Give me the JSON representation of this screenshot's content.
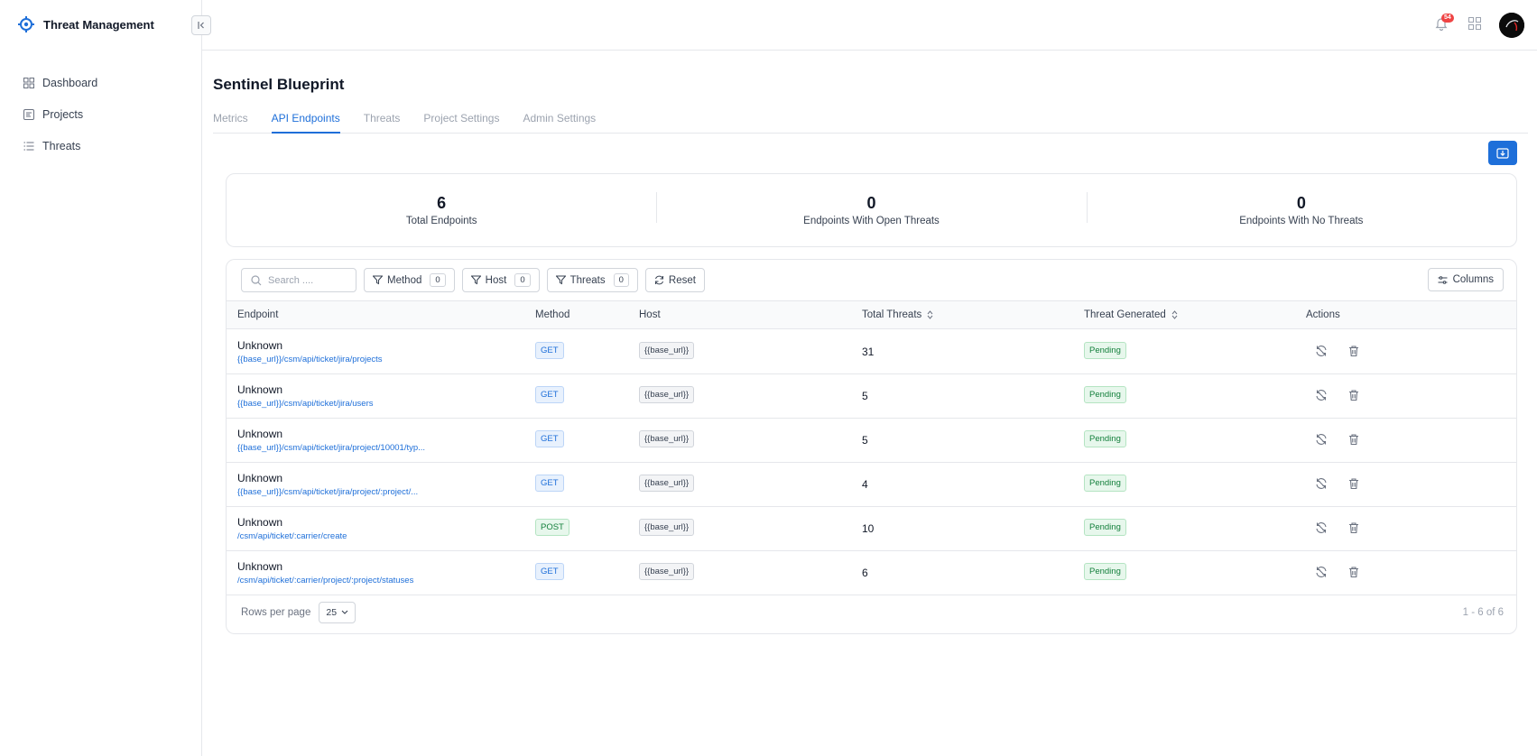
{
  "app": {
    "title": "Threat Management"
  },
  "sidebar": {
    "items": [
      {
        "label": "Dashboard",
        "icon": "grid-icon"
      },
      {
        "label": "Projects",
        "icon": "project-icon"
      },
      {
        "label": "Threats",
        "icon": "list-icon"
      }
    ]
  },
  "header": {
    "notification_count": "54"
  },
  "page": {
    "title": "Sentinel Blueprint",
    "tabs": [
      "Metrics",
      "API Endpoints",
      "Threats",
      "Project Settings",
      "Admin Settings"
    ],
    "active_tab": "API Endpoints"
  },
  "stats": [
    {
      "value": "6",
      "label": "Total Endpoints"
    },
    {
      "value": "0",
      "label": "Endpoints With Open Threats"
    },
    {
      "value": "0",
      "label": "Endpoints With No Threats"
    }
  ],
  "toolbar": {
    "search_placeholder": "Search ....",
    "filters": [
      {
        "label": "Method",
        "count": "0"
      },
      {
        "label": "Host",
        "count": "0"
      },
      {
        "label": "Threats",
        "count": "0"
      }
    ],
    "reset_label": "Reset",
    "columns_label": "Columns"
  },
  "table": {
    "headers": [
      "Endpoint",
      "Method",
      "Host",
      "Total Threats",
      "Threat Generated",
      "Actions"
    ],
    "rows": [
      {
        "name": "Unknown",
        "path": "{{base_url}}/csm/api/ticket/jira/projects",
        "method": "GET",
        "host": "{{base_url}}",
        "threats": "31",
        "status": "Pending"
      },
      {
        "name": "Unknown",
        "path": "{{base_url}}/csm/api/ticket/jira/users",
        "method": "GET",
        "host": "{{base_url}}",
        "threats": "5",
        "status": "Pending"
      },
      {
        "name": "Unknown",
        "path": "{{base_url}}/csm/api/ticket/jira/project/10001/typ...",
        "method": "GET",
        "host": "{{base_url}}",
        "threats": "5",
        "status": "Pending"
      },
      {
        "name": "Unknown",
        "path": "{{base_url}}/csm/api/ticket/jira/project/:project/...",
        "method": "GET",
        "host": "{{base_url}}",
        "threats": "4",
        "status": "Pending"
      },
      {
        "name": "Unknown",
        "path": "/csm/api/ticket/:carrier/create",
        "method": "POST",
        "host": "{{base_url}}",
        "threats": "10",
        "status": "Pending"
      },
      {
        "name": "Unknown",
        "path": "/csm/api/ticket/:carrier/project/:project/statuses",
        "method": "GET",
        "host": "{{base_url}}",
        "threats": "6",
        "status": "Pending"
      }
    ]
  },
  "pagination": {
    "rows_per_page_label": "Rows per page",
    "rows_per_page": "25",
    "range": "1 - 6 of 6"
  },
  "colors": {
    "accent": "#1e6fd9",
    "badge_red": "#ef4444",
    "success": "#15803d"
  }
}
